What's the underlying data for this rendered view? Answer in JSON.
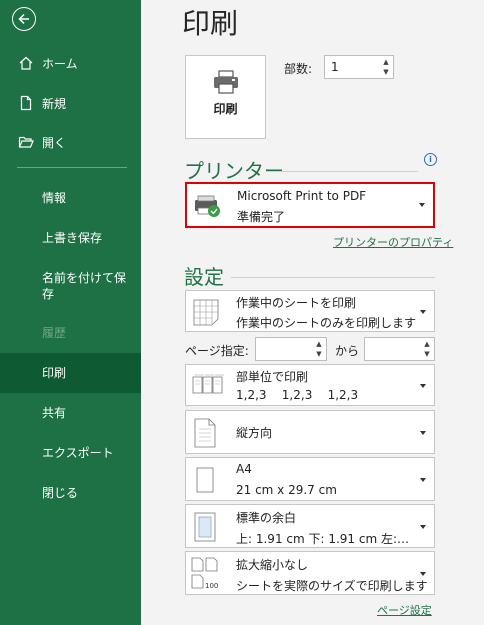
{
  "sidebar": {
    "items": [
      {
        "label": "ホーム",
        "icon": "home-icon"
      },
      {
        "label": "新規",
        "icon": "new-document-icon"
      },
      {
        "label": "開く",
        "icon": "open-folder-icon"
      },
      {
        "label": "情報"
      },
      {
        "label": "上書き保存"
      },
      {
        "label": "名前を付けて保存"
      },
      {
        "label": "履歴",
        "disabled": true
      },
      {
        "label": "印刷",
        "selected": true
      },
      {
        "label": "共有"
      },
      {
        "label": "エクスポート"
      },
      {
        "label": "閉じる"
      }
    ]
  },
  "main": {
    "title": "印刷",
    "print_button_label": "印刷",
    "copies_label": "部数:",
    "copies_value": "1",
    "printer_section": "プリンター",
    "printer_name": "Microsoft Print to PDF",
    "printer_status": "準備完了",
    "printer_properties_link": "プリンターのプロパティ",
    "settings_section": "設定",
    "settings": [
      {
        "line1": "作業中のシートを印刷",
        "line2": "作業中のシートのみを印刷します",
        "icon": "sheet-grid-icon"
      },
      {
        "line1": "部単位で印刷",
        "line2": "1,2,3    1,2,3    1,2,3",
        "icon": "collate-icon"
      },
      {
        "line1": "縦方向",
        "line2": "",
        "icon": "portrait-icon"
      },
      {
        "line1": "A4",
        "line2": "21 cm x 29.7 cm",
        "icon": "paper-size-icon"
      },
      {
        "line1": "標準の余白",
        "line2": "上: 1.91 cm 下: 1.91 cm 左:…",
        "icon": "margins-icon"
      },
      {
        "line1": "拡大縮小なし",
        "line2": "シートを実際のサイズで印刷します",
        "icon": "scaling-icon"
      }
    ],
    "pages_label": "ページ指定:",
    "pages_to_label": "から",
    "page_setup_link": "ページ設定"
  },
  "colors": {
    "accent": "#217346",
    "sidebar": "#1e7145",
    "selected": "#0e5a32",
    "printer_highlight": "#e00000"
  }
}
